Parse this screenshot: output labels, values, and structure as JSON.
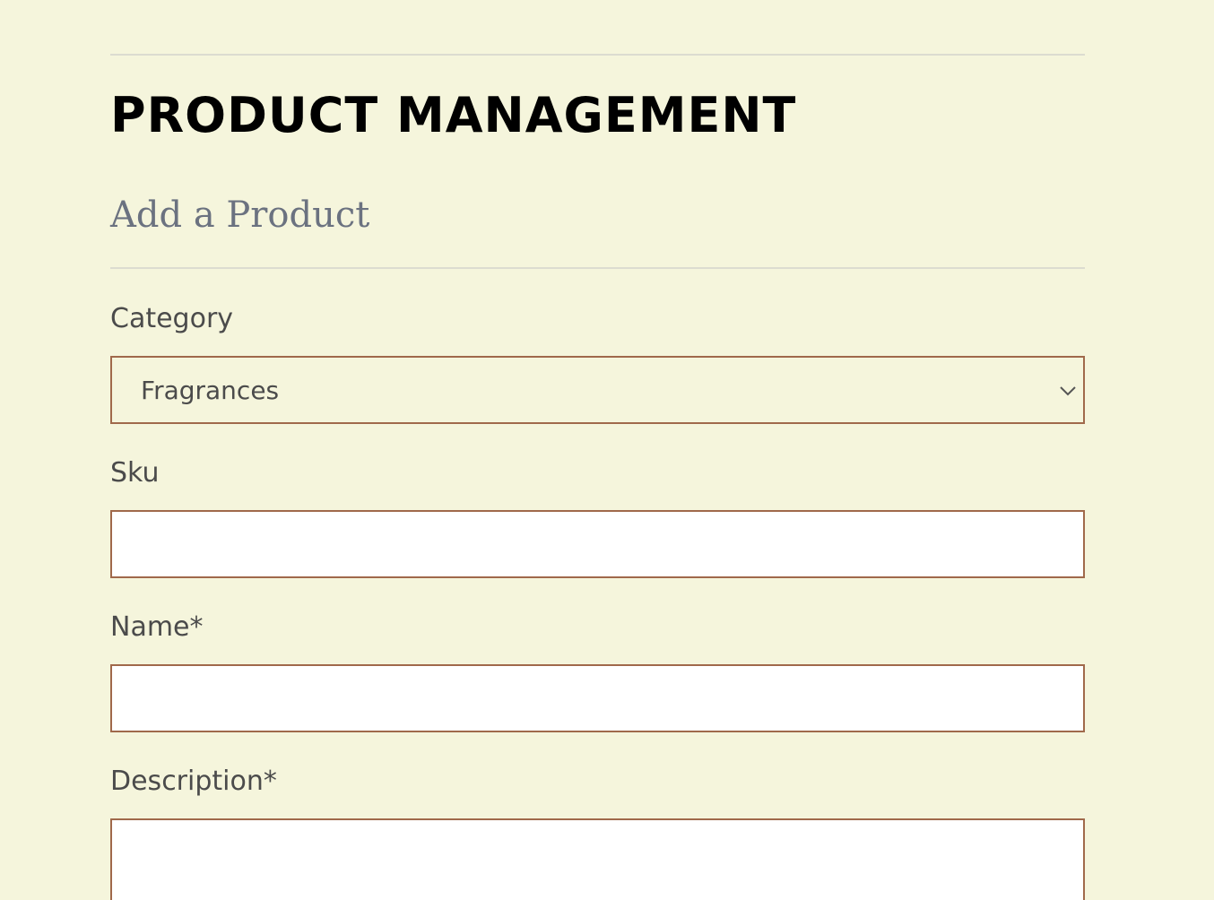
{
  "header": {
    "title": "PRODUCT MANAGEMENT"
  },
  "form": {
    "section_title": "Add a Product",
    "category": {
      "label": "Category",
      "selected": "Fragrances"
    },
    "sku": {
      "label": "Sku",
      "value": ""
    },
    "name": {
      "label": "Name*",
      "value": ""
    },
    "description": {
      "label": "Description*",
      "value": ""
    }
  },
  "icons": {
    "category_dropdown": "chevron-down-icon"
  },
  "colors": {
    "background": "#f5f5dc",
    "input_border": "#a0694b",
    "input_background": "#ffffff",
    "title": "#000000",
    "section_title": "#6b7280",
    "label": "#4b4b4b"
  }
}
